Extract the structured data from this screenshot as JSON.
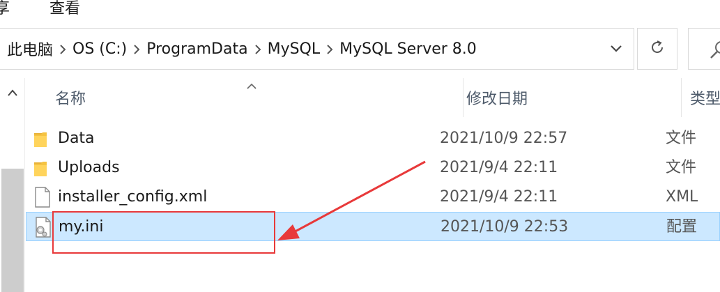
{
  "ribbon": {
    "tabs": [
      "享",
      "查看"
    ]
  },
  "address": {
    "crumbs": [
      "此电脑",
      "OS (C:)",
      "ProgramData",
      "MySQL",
      "MySQL Server 8.0"
    ],
    "icons": {
      "separator": "chevron-right-icon",
      "dropdown": "chevron-down-icon",
      "refresh": "refresh-icon",
      "search": "search-icon"
    }
  },
  "columns": {
    "name": "名称",
    "date": "修改日期",
    "type": "类型"
  },
  "files": [
    {
      "name": "Data",
      "date": "2021/10/9 22:57",
      "type": "文件",
      "icon": "folder-icon"
    },
    {
      "name": "Uploads",
      "date": "2021/9/4 22:11",
      "type": "文件",
      "icon": "folder-icon"
    },
    {
      "name": "installer_config.xml",
      "date": "2021/9/4 22:11",
      "type": "XML",
      "icon": "document-icon"
    },
    {
      "name": "my.ini",
      "date": "2021/10/9 22:53",
      "type": "配置",
      "icon": "config-file-icon",
      "selected": true
    }
  ],
  "colors": {
    "selection": "#cce8ff",
    "selection_border": "#99d1ff",
    "annotation": "#e8393a",
    "folder": "#f5c342"
  }
}
